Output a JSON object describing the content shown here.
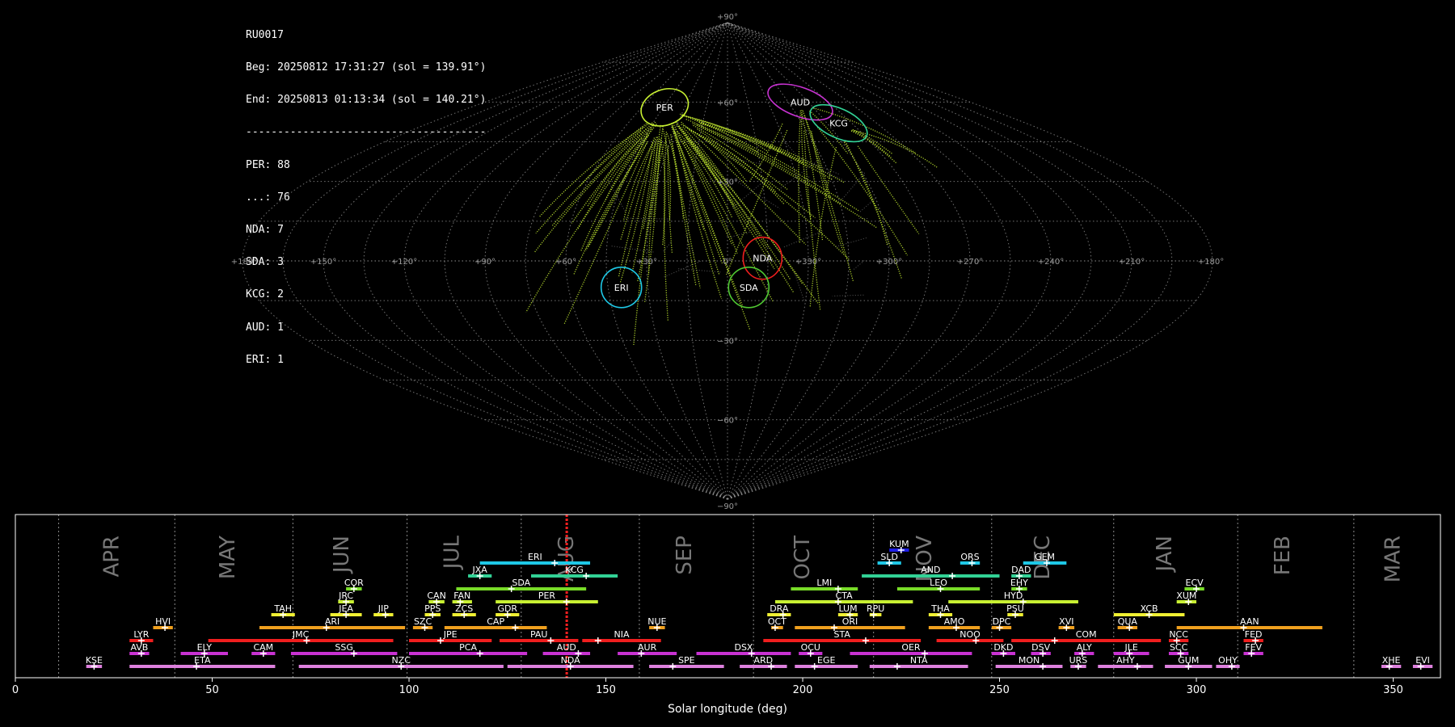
{
  "info": {
    "station": "RU0017",
    "begin": "Beg: 20250812 17:31:27 (sol = 139.91°)",
    "end": "End: 20250813 01:13:34 (sol = 140.21°)",
    "separator": "--------------------------------------",
    "counts": [
      "PER: 88",
      "...: 76",
      "NDA: 7",
      "SDA: 3",
      "KCG: 2",
      "AUD: 1",
      "ERI: 1"
    ]
  },
  "sky_map": {
    "projection": "sinusoidal",
    "lon_labels": [
      "+180°",
      "+150°",
      "+120°",
      "+90°",
      "+60°",
      "+30°",
      "0°",
      "+330°",
      "+300°",
      "+270°",
      "+240°",
      "+210°",
      "+180°"
    ],
    "lat_labels": [
      "+90°",
      "+60°",
      "+30°",
      "−30°",
      "−60°",
      "−90°"
    ],
    "radiants": [
      {
        "code": "PER",
        "lon": 44,
        "lat": 58,
        "color": "#c8f032"
      },
      {
        "code": "AUD",
        "lon": 306,
        "lat": 60,
        "color": "#c832d2"
      },
      {
        "code": "KCG",
        "lon": 293,
        "lat": 52,
        "color": "#32d296"
      },
      {
        "code": "NDA",
        "lon": 347,
        "lat": 1,
        "color": "#f01e1e"
      },
      {
        "code": "SDA",
        "lon": 352,
        "lat": -10,
        "color": "#50c832"
      },
      {
        "code": "ERI",
        "lon": 40,
        "lat": -10,
        "color": "#1ec8e6"
      }
    ]
  },
  "chart_data": {
    "type": "timeline",
    "xlabel": "Solar longitude (deg)",
    "xlim": [
      0,
      362
    ],
    "xticks": [
      0,
      50,
      100,
      150,
      200,
      250,
      300,
      350
    ],
    "current_sol": [
      139.91,
      140.21
    ],
    "months": [
      {
        "name": "APR",
        "at": 24.5
      },
      {
        "name": "MAY",
        "at": 54
      },
      {
        "name": "JUN",
        "at": 83
      },
      {
        "name": "JUL",
        "at": 111
      },
      {
        "name": "AUG",
        "at": 140
      },
      {
        "name": "SEP",
        "at": 170
      },
      {
        "name": "OCT",
        "at": 200
      },
      {
        "name": "NOV",
        "at": 231
      },
      {
        "name": "DEC",
        "at": 261
      },
      {
        "name": "JAN",
        "at": 292
      },
      {
        "name": "FEB",
        "at": 322
      },
      {
        "name": "MAR",
        "at": 350
      }
    ],
    "month_dividers": [
      11,
      40.5,
      70.5,
      99.5,
      128.5,
      158.5,
      187.5,
      218,
      248,
      279,
      310.5,
      340
    ],
    "showers": [
      {
        "code": "KSE",
        "start": 18,
        "end": 22,
        "peak": 20,
        "row": 0,
        "color": "#dd80dd"
      },
      {
        "code": "ETA",
        "start": 29,
        "end": 66,
        "peak": 46,
        "row": 0,
        "color": "#dd80dd"
      },
      {
        "code": "NZC",
        "start": 72,
        "end": 124,
        "peak": 98,
        "row": 0,
        "color": "#dd80dd"
      },
      {
        "code": "NDA",
        "start": 125,
        "end": 157,
        "peak": 141,
        "row": 0,
        "color": "#dd80dd"
      },
      {
        "code": "SPE",
        "start": 161,
        "end": 180,
        "peak": 167,
        "row": 0,
        "color": "#dd80dd"
      },
      {
        "code": "ARD",
        "start": 184,
        "end": 196,
        "peak": 192,
        "row": 0,
        "color": "#dd80dd"
      },
      {
        "code": "EGE",
        "start": 198,
        "end": 214,
        "peak": 203,
        "row": 0,
        "color": "#dd80dd"
      },
      {
        "code": "NTA",
        "start": 217,
        "end": 242,
        "peak": 224,
        "row": 0,
        "color": "#dd80dd"
      },
      {
        "code": "MON",
        "start": 249,
        "end": 266,
        "peak": 261,
        "row": 0,
        "color": "#dd80dd"
      },
      {
        "code": "URS",
        "start": 268,
        "end": 272,
        "peak": 270,
        "row": 0,
        "color": "#dd80dd"
      },
      {
        "code": "AHY",
        "start": 275,
        "end": 289,
        "peak": 285,
        "row": 0,
        "color": "#dd80dd"
      },
      {
        "code": "GUM",
        "start": 292,
        "end": 304,
        "peak": 298,
        "row": 0,
        "color": "#dd80dd"
      },
      {
        "code": "OHY",
        "start": 305,
        "end": 311,
        "peak": 309,
        "row": 0,
        "color": "#dd80dd"
      },
      {
        "code": "XHE",
        "start": 347,
        "end": 352,
        "peak": 349,
        "row": 0,
        "color": "#dd80dd"
      },
      {
        "code": "EVI",
        "start": 355,
        "end": 360,
        "peak": 357,
        "row": 0,
        "color": "#dd80dd"
      },
      {
        "code": "AVB",
        "start": 29,
        "end": 34,
        "peak": 32,
        "row": 1,
        "color": "#c832d2"
      },
      {
        "code": "ELY",
        "start": 42,
        "end": 54,
        "peak": 48,
        "row": 1,
        "color": "#c832d2"
      },
      {
        "code": "CAM",
        "start": 60,
        "end": 66,
        "peak": 63,
        "row": 1,
        "color": "#c832d2"
      },
      {
        "code": "SSG",
        "start": 70,
        "end": 97,
        "peak": 86,
        "row": 1,
        "color": "#c832d2"
      },
      {
        "code": "PCA",
        "start": 100,
        "end": 130,
        "peak": 118,
        "row": 1,
        "color": "#c832d2"
      },
      {
        "code": "AUD",
        "start": 134,
        "end": 146,
        "peak": 143,
        "row": 1,
        "color": "#c832d2"
      },
      {
        "code": "AUR",
        "start": 153,
        "end": 168,
        "peak": 159,
        "row": 1,
        "color": "#c832d2"
      },
      {
        "code": "DSX",
        "start": 173,
        "end": 197,
        "peak": 187,
        "row": 1,
        "color": "#c832d2"
      },
      {
        "code": "OCU",
        "start": 199,
        "end": 205,
        "peak": 202,
        "row": 1,
        "color": "#c832d2"
      },
      {
        "code": "OER",
        "start": 212,
        "end": 243,
        "peak": 231,
        "row": 1,
        "color": "#c832d2"
      },
      {
        "code": "DKD",
        "start": 248,
        "end": 254,
        "peak": 251,
        "row": 1,
        "color": "#c832d2"
      },
      {
        "code": "DSV",
        "start": 258,
        "end": 263,
        "peak": 261,
        "row": 1,
        "color": "#c832d2"
      },
      {
        "code": "ALY",
        "start": 269,
        "end": 274,
        "peak": 271,
        "row": 1,
        "color": "#c832d2"
      },
      {
        "code": "JLE",
        "start": 279,
        "end": 288,
        "peak": 283,
        "row": 1,
        "color": "#c832d2"
      },
      {
        "code": "SCC",
        "start": 293,
        "end": 298,
        "peak": 296,
        "row": 1,
        "color": "#c832d2"
      },
      {
        "code": "FEV",
        "start": 312,
        "end": 317,
        "peak": 314,
        "row": 1,
        "color": "#c832d2"
      },
      {
        "code": "LYR",
        "start": 29,
        "end": 35,
        "peak": 32,
        "row": 2,
        "color": "#f01e1e"
      },
      {
        "code": "JMC",
        "start": 49,
        "end": 96,
        "peak": 74,
        "row": 2,
        "color": "#f01e1e"
      },
      {
        "code": "JPE",
        "start": 100,
        "end": 121,
        "peak": 108,
        "row": 2,
        "color": "#f01e1e"
      },
      {
        "code": "PAU",
        "start": 123,
        "end": 143,
        "peak": 136,
        "row": 2,
        "color": "#f01e1e"
      },
      {
        "code": "NIA",
        "start": 144,
        "end": 164,
        "peak": 148,
        "row": 2,
        "color": "#f01e1e"
      },
      {
        "code": "STA",
        "start": 190,
        "end": 230,
        "peak": 216,
        "row": 2,
        "color": "#f01e1e"
      },
      {
        "code": "NOO",
        "start": 234,
        "end": 251,
        "peak": 244,
        "row": 2,
        "color": "#f01e1e"
      },
      {
        "code": "COM",
        "start": 253,
        "end": 291,
        "peak": 264,
        "row": 2,
        "color": "#f01e1e"
      },
      {
        "code": "NCC",
        "start": 293,
        "end": 298,
        "peak": 295,
        "row": 2,
        "color": "#f01e1e"
      },
      {
        "code": "FED",
        "start": 312,
        "end": 317,
        "peak": 315,
        "row": 2,
        "color": "#f01e1e"
      },
      {
        "code": "HVI",
        "start": 35,
        "end": 40,
        "peak": 38,
        "row": 3,
        "color": "#f0a01e"
      },
      {
        "code": "ARI",
        "start": 62,
        "end": 99,
        "peak": 79,
        "row": 3,
        "color": "#f0a01e"
      },
      {
        "code": "SZC",
        "start": 101,
        "end": 106,
        "peak": 104,
        "row": 3,
        "color": "#f0a01e"
      },
      {
        "code": "CAP",
        "start": 109,
        "end": 135,
        "peak": 127,
        "row": 3,
        "color": "#f0a01e"
      },
      {
        "code": "NUE",
        "start": 161,
        "end": 165,
        "peak": 163,
        "row": 3,
        "color": "#f0a01e"
      },
      {
        "code": "OCT",
        "start": 192,
        "end": 195,
        "peak": 193,
        "row": 3,
        "color": "#f0a01e"
      },
      {
        "code": "ORI",
        "start": 198,
        "end": 226,
        "peak": 208,
        "row": 3,
        "color": "#f0a01e"
      },
      {
        "code": "AMO",
        "start": 232,
        "end": 245,
        "peak": 239,
        "row": 3,
        "color": "#f0a01e"
      },
      {
        "code": "DPC",
        "start": 248,
        "end": 253,
        "peak": 250,
        "row": 3,
        "color": "#f0a01e"
      },
      {
        "code": "XVI",
        "start": 265,
        "end": 269,
        "peak": 267,
        "row": 3,
        "color": "#f0a01e"
      },
      {
        "code": "QUA",
        "start": 280,
        "end": 285,
        "peak": 283,
        "row": 3,
        "color": "#f0a01e"
      },
      {
        "code": "AAN",
        "start": 295,
        "end": 332,
        "peak": 312,
        "row": 3,
        "color": "#f0a01e"
      },
      {
        "code": "TAH",
        "start": 65,
        "end": 71,
        "peak": 68,
        "row": 4,
        "color": "#f0f032"
      },
      {
        "code": "JEA",
        "start": 80,
        "end": 88,
        "peak": 84,
        "row": 4,
        "color": "#f0f032"
      },
      {
        "code": "JIP",
        "start": 91,
        "end": 96,
        "peak": 94,
        "row": 4,
        "color": "#f0f032"
      },
      {
        "code": "PPS",
        "start": 104,
        "end": 108,
        "peak": 106,
        "row": 4,
        "color": "#f0f032"
      },
      {
        "code": "ZCS",
        "start": 111,
        "end": 117,
        "peak": 114,
        "row": 4,
        "color": "#f0f032"
      },
      {
        "code": "GDR",
        "start": 122,
        "end": 128,
        "peak": 125,
        "row": 4,
        "color": "#f0f032"
      },
      {
        "code": "DRA",
        "start": 191,
        "end": 197,
        "peak": 195,
        "row": 4,
        "color": "#f0f032"
      },
      {
        "code": "LUM",
        "start": 209,
        "end": 214,
        "peak": 212,
        "row": 4,
        "color": "#f0f032"
      },
      {
        "code": "RPU",
        "start": 217,
        "end": 220,
        "peak": 218,
        "row": 4,
        "color": "#f0f032"
      },
      {
        "code": "THA",
        "start": 232,
        "end": 238,
        "peak": 235,
        "row": 4,
        "color": "#f0f032"
      },
      {
        "code": "PSU",
        "start": 252,
        "end": 256,
        "peak": 254,
        "row": 4,
        "color": "#f0f032"
      },
      {
        "code": "XCB",
        "start": 279,
        "end": 297,
        "peak": 288,
        "row": 4,
        "color": "#f0f032"
      },
      {
        "code": "JRC",
        "start": 82,
        "end": 86,
        "peak": 84,
        "row": 5,
        "color": "#c8f032"
      },
      {
        "code": "CAN",
        "start": 105,
        "end": 109,
        "peak": 107,
        "row": 5,
        "color": "#c8f032"
      },
      {
        "code": "FAN",
        "start": 111,
        "end": 116,
        "peak": 113,
        "row": 5,
        "color": "#c8f032"
      },
      {
        "code": "PER",
        "start": 122,
        "end": 148,
        "peak": 140,
        "row": 5,
        "color": "#c8f032"
      },
      {
        "code": "CTA",
        "start": 193,
        "end": 228,
        "peak": 209,
        "row": 5,
        "color": "#c8f032"
      },
      {
        "code": "HYD",
        "start": 237,
        "end": 270,
        "peak": 256,
        "row": 5,
        "color": "#c8f032"
      },
      {
        "code": "XUM",
        "start": 295,
        "end": 300,
        "peak": 298,
        "row": 5,
        "color": "#c8f032"
      },
      {
        "code": "COR",
        "start": 84,
        "end": 88,
        "peak": 86,
        "row": 6,
        "color": "#78dc28"
      },
      {
        "code": "SDA",
        "start": 112,
        "end": 145,
        "peak": 126,
        "row": 6,
        "color": "#78dc28"
      },
      {
        "code": "LMI",
        "start": 197,
        "end": 214,
        "peak": 209,
        "row": 6,
        "color": "#78dc28"
      },
      {
        "code": "LEO",
        "start": 224,
        "end": 245,
        "peak": 235,
        "row": 6,
        "color": "#78dc28"
      },
      {
        "code": "EHY",
        "start": 253,
        "end": 257,
        "peak": 255,
        "row": 6,
        "color": "#78dc28"
      },
      {
        "code": "ECV",
        "start": 297,
        "end": 302,
        "peak": 300,
        "row": 6,
        "color": "#78dc28"
      },
      {
        "code": "JXA",
        "start": 115,
        "end": 121,
        "peak": 118,
        "row": 7,
        "color": "#32d296"
      },
      {
        "code": "KCG",
        "start": 131,
        "end": 153,
        "peak": 145,
        "row": 7,
        "color": "#32d296"
      },
      {
        "code": "AND",
        "start": 215,
        "end": 250,
        "peak": 238,
        "row": 7,
        "color": "#32d296"
      },
      {
        "code": "DAD",
        "start": 253,
        "end": 258,
        "peak": 255,
        "row": 7,
        "color": "#32d296"
      },
      {
        "code": "ERI",
        "start": 118,
        "end": 146,
        "peak": 137,
        "row": 8,
        "color": "#1ec8e6"
      },
      {
        "code": "SLD",
        "start": 219,
        "end": 225,
        "peak": 222,
        "row": 8,
        "color": "#1ec8e6"
      },
      {
        "code": "ORS",
        "start": 240,
        "end": 245,
        "peak": 243,
        "row": 8,
        "color": "#1ec8e6"
      },
      {
        "code": "GEM",
        "start": 256,
        "end": 267,
        "peak": 262,
        "row": 8,
        "color": "#1ec8e6"
      },
      {
        "code": "KUM",
        "start": 222,
        "end": 227,
        "peak": 225,
        "row": 9,
        "color": "#1e1ee6"
      }
    ]
  }
}
